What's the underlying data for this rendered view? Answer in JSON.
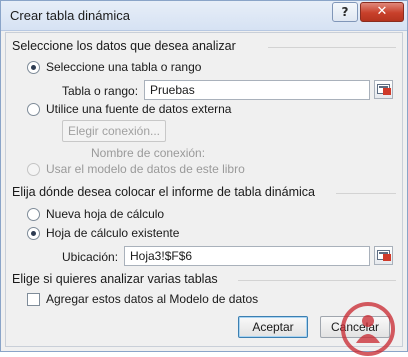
{
  "window": {
    "title": "Crear tabla dinámica",
    "help_glyph": "?",
    "close_glyph": "✕"
  },
  "data_section": {
    "title": "Seleccione los datos que desea analizar",
    "option_table": "Seleccione una tabla o rango",
    "table_label": "Tabla o rango:",
    "table_value": "Pruebas",
    "option_external": "Utilice una fuente de datos externa",
    "choose_connection": "Elegir conexión...",
    "connection_name_label": "Nombre de conexión:",
    "option_model": "Usar el modelo de datos de este libro"
  },
  "location_section": {
    "title": "Elija dónde desea colocar el informe de tabla dinámica",
    "option_new": "Nueva hoja de cálculo",
    "option_existing": "Hoja de cálculo existente",
    "location_label": "Ubicación:",
    "location_value": "Hoja3!$F$6"
  },
  "multi_section": {
    "title": "Elige si quieres analizar varias tablas",
    "add_to_model": "Agregar estos datos al Modelo de datos"
  },
  "footer": {
    "accept": "Aceptar",
    "cancel": "Cancelar"
  },
  "colors": {
    "close_button": "#c8402b",
    "watermark": "#c8262e"
  },
  "icons": {
    "range_selector": "range-selector-icon",
    "watermark": "watermark-logo-icon"
  }
}
